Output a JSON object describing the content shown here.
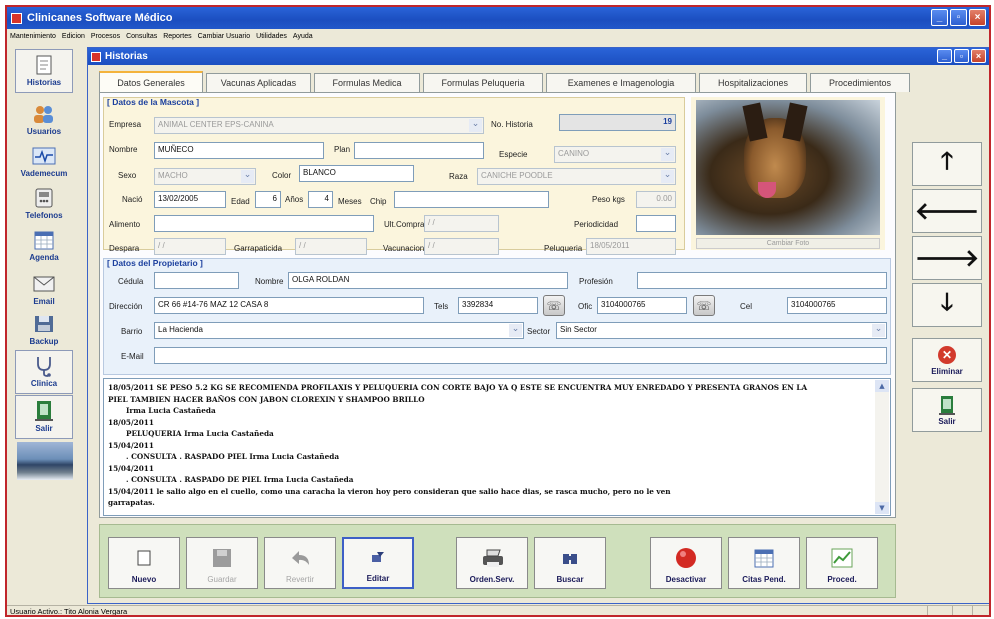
{
  "app": {
    "title": "Clinicanes Software Médico"
  },
  "menu": [
    "Mantenimiento",
    "Edicion",
    "Procesos",
    "Consultas",
    "Reportes",
    "Cambiar Usuario",
    "Utilidades",
    "Ayuda"
  ],
  "sidebar": [
    {
      "label": "Historias",
      "icon": "history-icon"
    },
    {
      "label": "Usuarios",
      "icon": "users-icon"
    },
    {
      "label": "Vademecum",
      "icon": "vademecum-icon"
    },
    {
      "label": "Telefonos",
      "icon": "phone-book-icon"
    },
    {
      "label": "Agenda",
      "icon": "calendar-icon"
    },
    {
      "label": "Email",
      "icon": "email-icon"
    },
    {
      "label": "Backup",
      "icon": "backup-icon"
    },
    {
      "label": "Clinica",
      "icon": "stethoscope-icon"
    },
    {
      "label": "Salir",
      "icon": "exit-icon"
    }
  ],
  "window": {
    "title": "Historias"
  },
  "tabs": [
    "Datos Generales",
    "Vacunas Aplicadas",
    "Formulas Medica",
    "Formulas Peluqueria",
    "Examenes e Imagenologia",
    "Hospitalizaciones",
    "Procedimientos"
  ],
  "pet": {
    "section_title": "[ Datos de la Mascota ]",
    "empresa_label": "Empresa",
    "empresa": "ANIMAL CENTER EPS-CANINA",
    "no_historia_label": "No. Historia",
    "no_historia": "19",
    "nombre_label": "Nombre",
    "nombre": "MUÑECO",
    "plan_label": "Plan",
    "plan": "",
    "especie_label": "Especie",
    "especie": "CANINO",
    "sexo_label": "Sexo",
    "sexo": "MACHO",
    "color_label": "Color",
    "color": "BLANCO",
    "raza_label": "Raza",
    "raza": "CANICHE POODLE",
    "nacio_label": "Nació",
    "nacio": "13/02/2005",
    "edad_label": "Edad",
    "edad_anos": "6",
    "anos_label": "Años",
    "edad_meses": "4",
    "meses_label": "Meses",
    "chip_label": "Chip",
    "chip": "",
    "peso_label": "Peso kgs",
    "peso": "0.00",
    "alimento_label": "Alimento",
    "alimento": "",
    "ult_compra_label": "Ult.Compra",
    "ult_compra": "/ /",
    "periodicidad_label": "Periodicidad",
    "periodicidad": "",
    "despara_label": "Despara",
    "despara": "/ /",
    "garrapaticida_label": "Garrapaticida",
    "garrapaticida": "/ /",
    "vacunacion_label": "Vacunacion",
    "vacunacion": "/ /",
    "peluqueria_label": "Peluqueria",
    "peluqueria": "18/05/2011",
    "photo_button": "Cambiar Foto"
  },
  "owner": {
    "section_title": "[ Datos del Propietario ]",
    "cedula_label": "Cédula",
    "cedula": "",
    "nombre_label": "Nombre",
    "nombre": "OLGA ROLDAN",
    "profesion_label": "Profesión",
    "profesion": "",
    "direccion_label": "Dirección",
    "direccion": "CR 66 #14-76 MAZ 12 CASA 8",
    "tels_label": "Tels",
    "tels": "3392834",
    "ofic_label": "Ofic",
    "ofic": "3104000765",
    "cel_label": "Cel",
    "cel": "3104000765",
    "barrio_label": "Barrio",
    "barrio": "La Hacienda",
    "sector_label": "Sector",
    "sector": "Sin Sector",
    "email_label": "E-Mail",
    "email": ""
  },
  "notes": [
    {
      "text": "18/05/2011  SE PESO 5.2 KG SE RECOMIENDA PROFILAXIS Y PELUQUERIA CON CORTE BAJO YA Q ESTE SE ENCUENTRA MUY ENREDADO Y PRESENTA GRANOS EN LA",
      "indent": false
    },
    {
      "text": "PIEL TAMBIEN HACER BAÑOS CON  JABON CLOREXIN Y SHAMPOO BRILLO",
      "indent": false
    },
    {
      "text": "Irma Lucia Castañeda",
      "indent": true
    },
    {
      "text": "18/05/2011",
      "indent": false
    },
    {
      "text": "PELUQUERIA Irma Lucia Castañeda",
      "indent": true
    },
    {
      "text": "15/04/2011",
      "indent": false
    },
    {
      "text": ". CONSULTA . RASPADO PIEL Irma Lucia Castañeda",
      "indent": true
    },
    {
      "text": "15/04/2011",
      "indent": false
    },
    {
      "text": ". CONSULTA . RASPADO DE PIEL Irma Lucia Castañeda",
      "indent": true
    },
    {
      "text": "15/04/2011  le salio algo en el cuello, como una caracha la vieron hoy pero consideran que salio hace dias, se rasca mucho, pero no le ven",
      "indent": false
    },
    {
      "text": "garrapatas.",
      "indent": false
    }
  ],
  "buttons": {
    "nuevo": "Nuevo",
    "guardar": "Guardar",
    "revertir": "Revertir",
    "editar": "Editar",
    "orden_serv": "Orden.Serv.",
    "buscar": "Buscar",
    "desactivar": "Desactivar",
    "citas_pend": "Citas Pend.",
    "proced": "Proced."
  },
  "rightnav": {
    "up": "🡑",
    "left": "🡐",
    "right": "🡒",
    "down": "🡓",
    "eliminar": "Eliminar",
    "salir": "Salir"
  },
  "status": {
    "usuario": "Usuario Activo.:  Tito Alonia Vergara"
  }
}
